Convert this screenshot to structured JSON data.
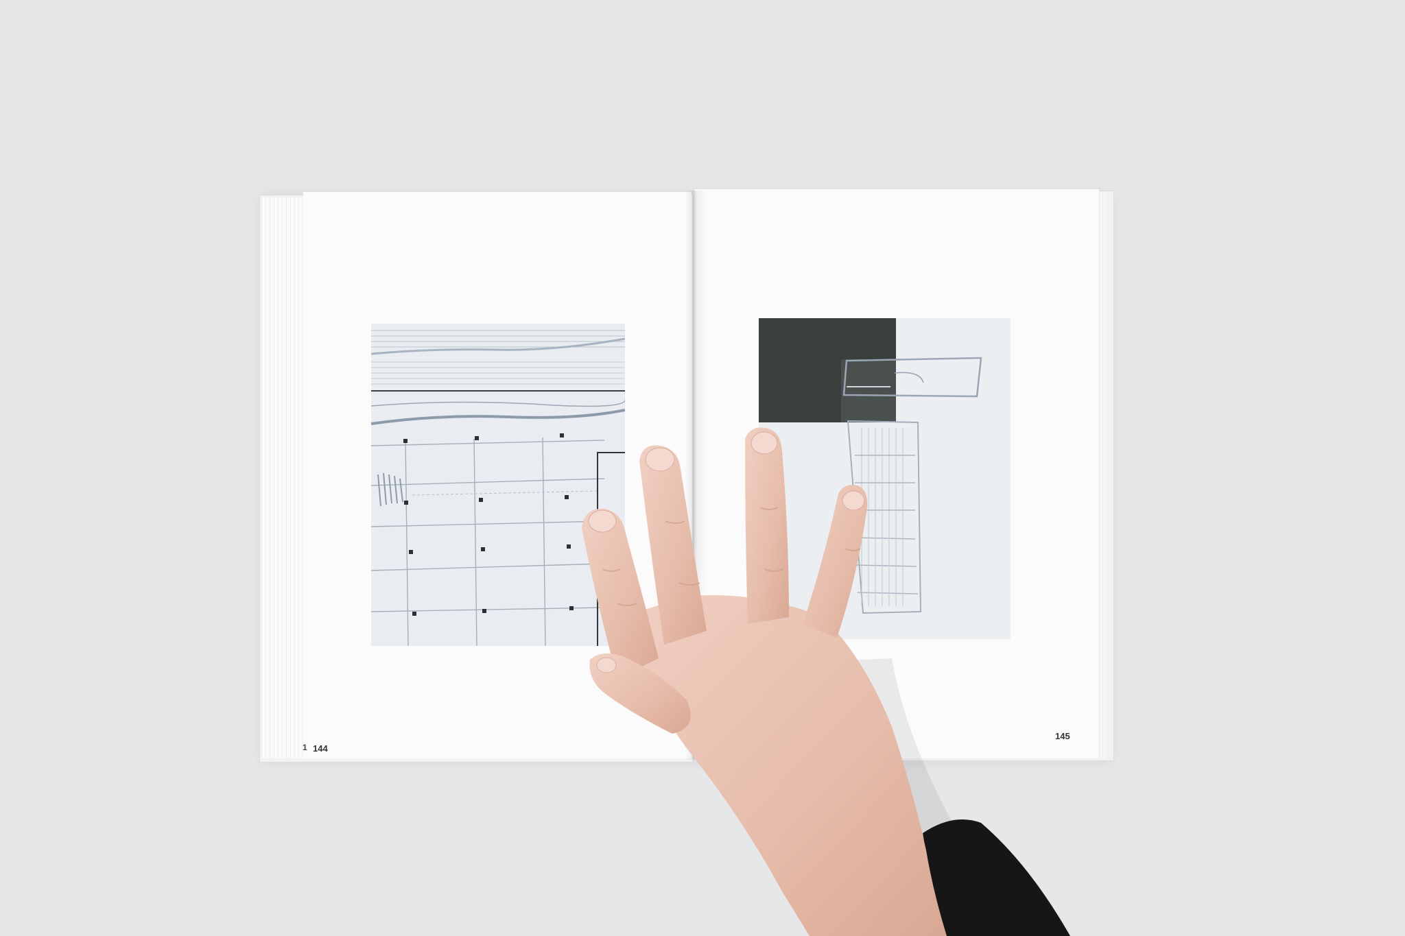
{
  "book": {
    "left_page_number": "144",
    "right_page_number": "145",
    "peek_page_number": "1"
  },
  "plates": {
    "left": {
      "description_icon": "pencil-grid-drawing"
    },
    "right": {
      "description_icon": "pencil-rectangle-drawing"
    }
  },
  "colors": {
    "background": "#e6e7e9",
    "page": "#fbfbfb",
    "plate_bg": "#e9edf1",
    "dark_block": "#3a3f3d",
    "pencil": "#9aa6b4",
    "skin": "#e9c3b4",
    "sleeve": "#151515"
  }
}
